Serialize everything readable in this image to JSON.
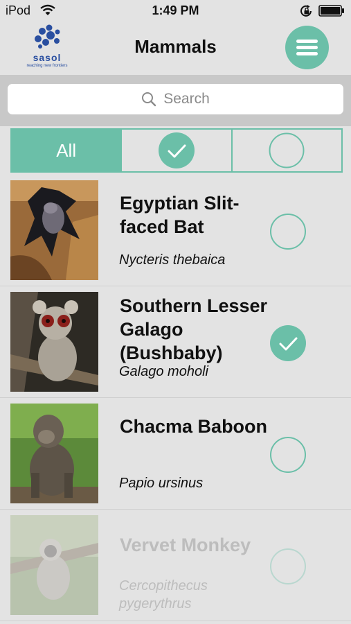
{
  "status_bar": {
    "carrier": "iPod",
    "time": "1:49 PM"
  },
  "header": {
    "title": "Mammals",
    "logo_text": "sasol",
    "logo_tagline": "reaching new frontiers"
  },
  "search": {
    "placeholder": "Search"
  },
  "filter": {
    "all_label": "All",
    "selected": "All"
  },
  "species": [
    {
      "name": "Egyptian Slit-faced Bat",
      "scientific": "Nycteris thebaica",
      "checked": false
    },
    {
      "name": "Southern Lesser Galago (Bushbaby)",
      "scientific": "Galago moholi",
      "checked": true
    },
    {
      "name": "Chacma Baboon",
      "scientific": "Papio ursinus",
      "checked": false
    },
    {
      "name": "Vervet Monkey",
      "scientific": "Cercopithecus pygerythrus",
      "checked": false
    }
  ],
  "colors": {
    "accent": "#6bbfa8",
    "background": "#e3e3e3",
    "search_band": "#c8c8c8"
  }
}
